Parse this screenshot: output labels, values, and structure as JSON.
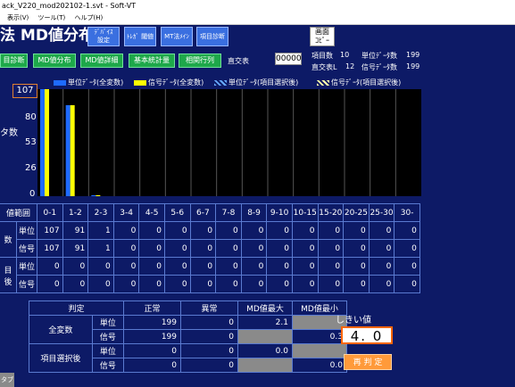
{
  "window": {
    "title": "ack_V220_mod202102-1.svt - Soft-VT"
  },
  "menu": {
    "items": [
      "表示(V)",
      "ツール(T)",
      "ヘルプ(H)"
    ]
  },
  "header": {
    "title": "法 MD値分布",
    "copy_button": "画面\nｺﾋﾟｰ"
  },
  "top_buttons": {
    "device": "ﾃﾞﾊﾞｲｽ\n設定",
    "threshold": "ﾄﾚｶﾞ 閾値",
    "mt": "MT法ﾒｲﾝ",
    "item_diag": "項目診断"
  },
  "nav_buttons": [
    "目診断",
    "MD値分布",
    "MD値詳細",
    "基本統計量",
    "相関行列"
  ],
  "orthogonal": {
    "label": "直交表",
    "value": "00000"
  },
  "info": {
    "items_label": "項目数",
    "items_value": "10",
    "unit_count_label": "単位ﾃﾞｰﾀ数",
    "unit_count_value": "199",
    "ortho_label": "直交表L",
    "ortho_value": "12",
    "signal_count_label": "信号ﾃﾞｰﾀ数",
    "signal_count_value": "199"
  },
  "legend": [
    "単位ﾃﾞｰﾀ(全変数)",
    "信号ﾃﾞｰﾀ(全変数)",
    "単位ﾃﾞｰﾀ(項目選択後)",
    "信号ﾃﾞｰﾀ(項目選択後)"
  ],
  "chart_data": {
    "type": "bar",
    "ylabel": "タ数",
    "ymax_label": "107",
    "yticks": [
      "80",
      "53",
      "26",
      "0"
    ],
    "ylim": [
      0,
      107
    ],
    "categories": [
      "0-1",
      "1-2",
      "2-3",
      "3-4",
      "4-5",
      "5-6",
      "6-7",
      "7-8",
      "8-9",
      "9-10",
      "10-15",
      "15-20",
      "20-25",
      "25-30",
      "30-"
    ],
    "series": [
      {
        "name": "単位ﾃﾞｰﾀ(全変数)",
        "color": "#1e6bff",
        "values": [
          107,
          91,
          1,
          0,
          0,
          0,
          0,
          0,
          0,
          0,
          0,
          0,
          0,
          0,
          0
        ]
      },
      {
        "name": "信号ﾃﾞｰﾀ(全変数)",
        "color": "#ffff00",
        "values": [
          107,
          91,
          1,
          0,
          0,
          0,
          0,
          0,
          0,
          0,
          0,
          0,
          0,
          0,
          0
        ]
      },
      {
        "name": "単位ﾃﾞｰﾀ(項目選択後)",
        "color": "#66aaff",
        "values": [
          0,
          0,
          0,
          0,
          0,
          0,
          0,
          0,
          0,
          0,
          0,
          0,
          0,
          0,
          0
        ]
      },
      {
        "name": "信号ﾃﾞｰﾀ(項目選択後)",
        "color": "#ffffaa",
        "values": [
          0,
          0,
          0,
          0,
          0,
          0,
          0,
          0,
          0,
          0,
          0,
          0,
          0,
          0,
          0
        ]
      }
    ],
    "grid": true
  },
  "table": {
    "range_label": "値範囲",
    "group1_label": "数",
    "group2_label_top": "目",
    "group2_label_bottom": "後",
    "row_labels": [
      "単位",
      "信号",
      "単位",
      "信号"
    ],
    "rows": [
      [
        "107",
        "91",
        "1",
        "0",
        "0",
        "0",
        "0",
        "0",
        "0",
        "0",
        "0",
        "0",
        "0",
        "0",
        "0"
      ],
      [
        "107",
        "91",
        "1",
        "0",
        "0",
        "0",
        "0",
        "0",
        "0",
        "0",
        "0",
        "0",
        "0",
        "0",
        "0"
      ],
      [
        "0",
        "0",
        "0",
        "0",
        "0",
        "0",
        "0",
        "0",
        "0",
        "0",
        "0",
        "0",
        "0",
        "0",
        "0"
      ],
      [
        "0",
        "0",
        "0",
        "0",
        "0",
        "0",
        "0",
        "0",
        "0",
        "0",
        "0",
        "0",
        "0",
        "0",
        "0"
      ]
    ]
  },
  "results": {
    "h_judge": "判定",
    "h_normal": "正常",
    "h_abnormal": "異常",
    "h_mdmax": "MD値最大",
    "h_mdmin": "MD値最小",
    "all_vars": "全変数",
    "after_select": "項目選択後",
    "unit": "単位",
    "signal": "信号",
    "r1": {
      "normal": "199",
      "abnormal": "0",
      "mdmax": "2.1",
      "mdmin": ""
    },
    "r2": {
      "normal": "199",
      "abnormal": "0",
      "mdmax": "",
      "mdmin": "0.3"
    },
    "r3": {
      "normal": "0",
      "abnormal": "0",
      "mdmax": "0.0",
      "mdmin": ""
    },
    "r4": {
      "normal": "0",
      "abnormal": "0",
      "mdmax": "",
      "mdmin": "0.0"
    }
  },
  "threshold": {
    "label": "しきい値",
    "value": "4. 0",
    "rejudge": "再 判 定"
  },
  "footer": {
    "tab": "タブ"
  }
}
